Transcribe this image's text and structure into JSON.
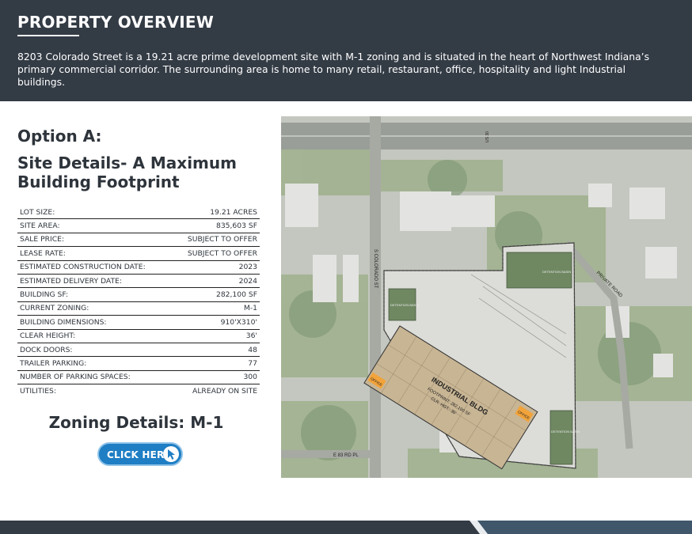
{
  "header": {
    "title": "PROPERTY OVERVIEW",
    "description": "8203 Colorado Street is a 19.21 acre prime development site with M-1 zoning and is situated in the heart of Northwest Indiana’s primary commercial corridor. The surrounding area is home to many retail, restaurant, office, hospitality and light Industrial buildings."
  },
  "option_label": "Option A:",
  "site_title": "Site Details- A Maximum Building Footprint",
  "details": [
    {
      "label": "LOT SIZE:",
      "value": "19.21 ACRES"
    },
    {
      "label": "SITE AREA:",
      "value": "835,603 SF"
    },
    {
      "label": "SALE PRICE:",
      "value": "SUBJECT TO OFFER"
    },
    {
      "label": "LEASE RATE:",
      "value": "SUBJECT TO OFFER"
    },
    {
      "label": "ESTIMATED CONSTRUCTION DATE:",
      "value": "2023"
    },
    {
      "label": "ESTIMATED DELIVERY DATE:",
      "value": "2024"
    },
    {
      "label": "BUILDING SF:",
      "value": "282,100 SF"
    },
    {
      "label": "CURRENT ZONING:",
      "value": "M-1"
    },
    {
      "label": "BUILDING DIMENSIONS:",
      "value": "910'X310'"
    },
    {
      "label": "CLEAR HEIGHT:",
      "value": "36'"
    },
    {
      "label": "DOCK DOORS:",
      "value": "48"
    },
    {
      "label": "TRAILER PARKING:",
      "value": "77"
    },
    {
      "label": "NUMBER OF PARKING SPACES:",
      "value": "300"
    },
    {
      "label": "UTILITIES:",
      "value": "ALREADY ON SITE"
    }
  ],
  "zoning_title": "Zoning Details: M-1",
  "button_label": "CLICK HERE",
  "map": {
    "street_colorado": "S COLORADO ST",
    "street_private": "PRIVATE ROAD",
    "street_83rd": "E 83 RD PL",
    "route": "US 30",
    "building_name": "INDUSTRIAL BLDG",
    "building_footprint": "FOOTPRINT: 282,100 SF",
    "building_height": "CLR. HGT.: 36'",
    "detention": "DETENTION BASIN",
    "office": "OFFICE"
  },
  "colors": {
    "header_bg": "#333b45",
    "button": "#1f7ec4",
    "building": "#c8b594"
  }
}
